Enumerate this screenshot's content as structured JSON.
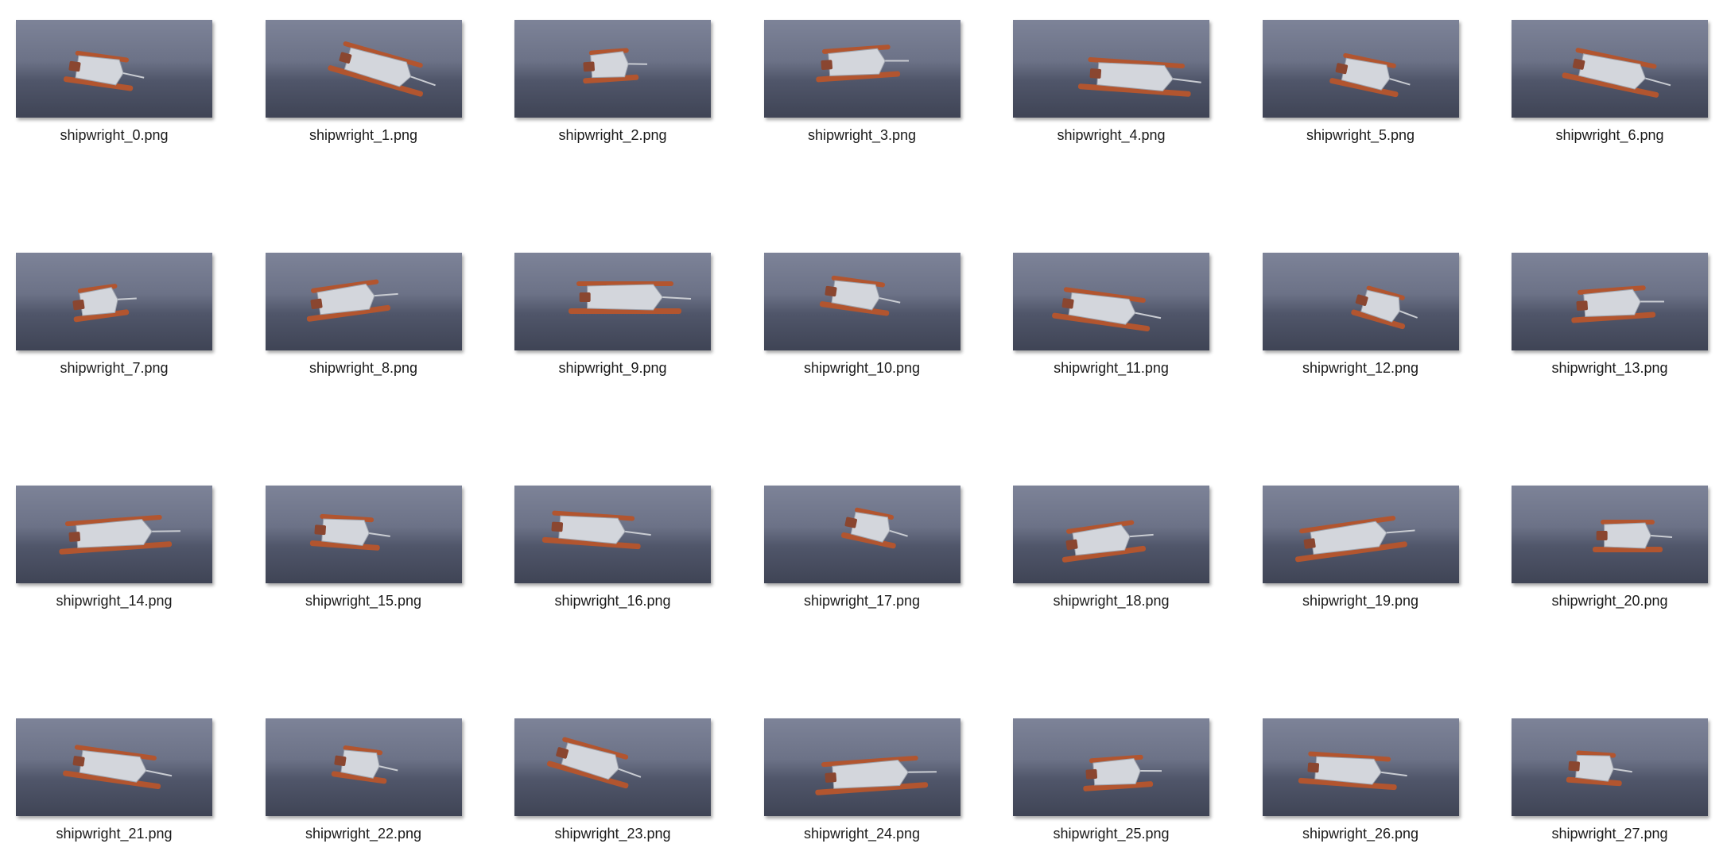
{
  "files": [
    {
      "name": "shipwright_0.png",
      "preview": "ship-render"
    },
    {
      "name": "shipwright_1.png",
      "preview": "ship-render"
    },
    {
      "name": "shipwright_2.png",
      "preview": "ship-render"
    },
    {
      "name": "shipwright_3.png",
      "preview": "ship-render"
    },
    {
      "name": "shipwright_4.png",
      "preview": "ship-render"
    },
    {
      "name": "shipwright_5.png",
      "preview": "ship-render"
    },
    {
      "name": "shipwright_6.png",
      "preview": "ship-render"
    },
    {
      "name": "shipwright_7.png",
      "preview": "ship-render"
    },
    {
      "name": "shipwright_8.png",
      "preview": "ship-render"
    },
    {
      "name": "shipwright_9.png",
      "preview": "ship-render"
    },
    {
      "name": "shipwright_10.png",
      "preview": "ship-render"
    },
    {
      "name": "shipwright_11.png",
      "preview": "ship-render"
    },
    {
      "name": "shipwright_12.png",
      "preview": "ship-render"
    },
    {
      "name": "shipwright_13.png",
      "preview": "ship-render"
    },
    {
      "name": "shipwright_14.png",
      "preview": "ship-render"
    },
    {
      "name": "shipwright_15.png",
      "preview": "ship-render"
    },
    {
      "name": "shipwright_16.png",
      "preview": "ship-render"
    },
    {
      "name": "shipwright_17.png",
      "preview": "ship-render"
    },
    {
      "name": "shipwright_18.png",
      "preview": "ship-render"
    },
    {
      "name": "shipwright_19.png",
      "preview": "ship-render"
    },
    {
      "name": "shipwright_20.png",
      "preview": "ship-render"
    },
    {
      "name": "shipwright_21.png",
      "preview": "ship-render"
    },
    {
      "name": "shipwright_22.png",
      "preview": "ship-render"
    },
    {
      "name": "shipwright_23.png",
      "preview": "ship-render"
    },
    {
      "name": "shipwright_24.png",
      "preview": "ship-render"
    },
    {
      "name": "shipwright_25.png",
      "preview": "ship-render"
    },
    {
      "name": "shipwright_26.png",
      "preview": "ship-render"
    },
    {
      "name": "shipwright_27.png",
      "preview": "ship-render"
    }
  ],
  "colors": {
    "hull": "#d3d6dc",
    "accent": "#b2552f",
    "shadow": "#8a4630"
  }
}
